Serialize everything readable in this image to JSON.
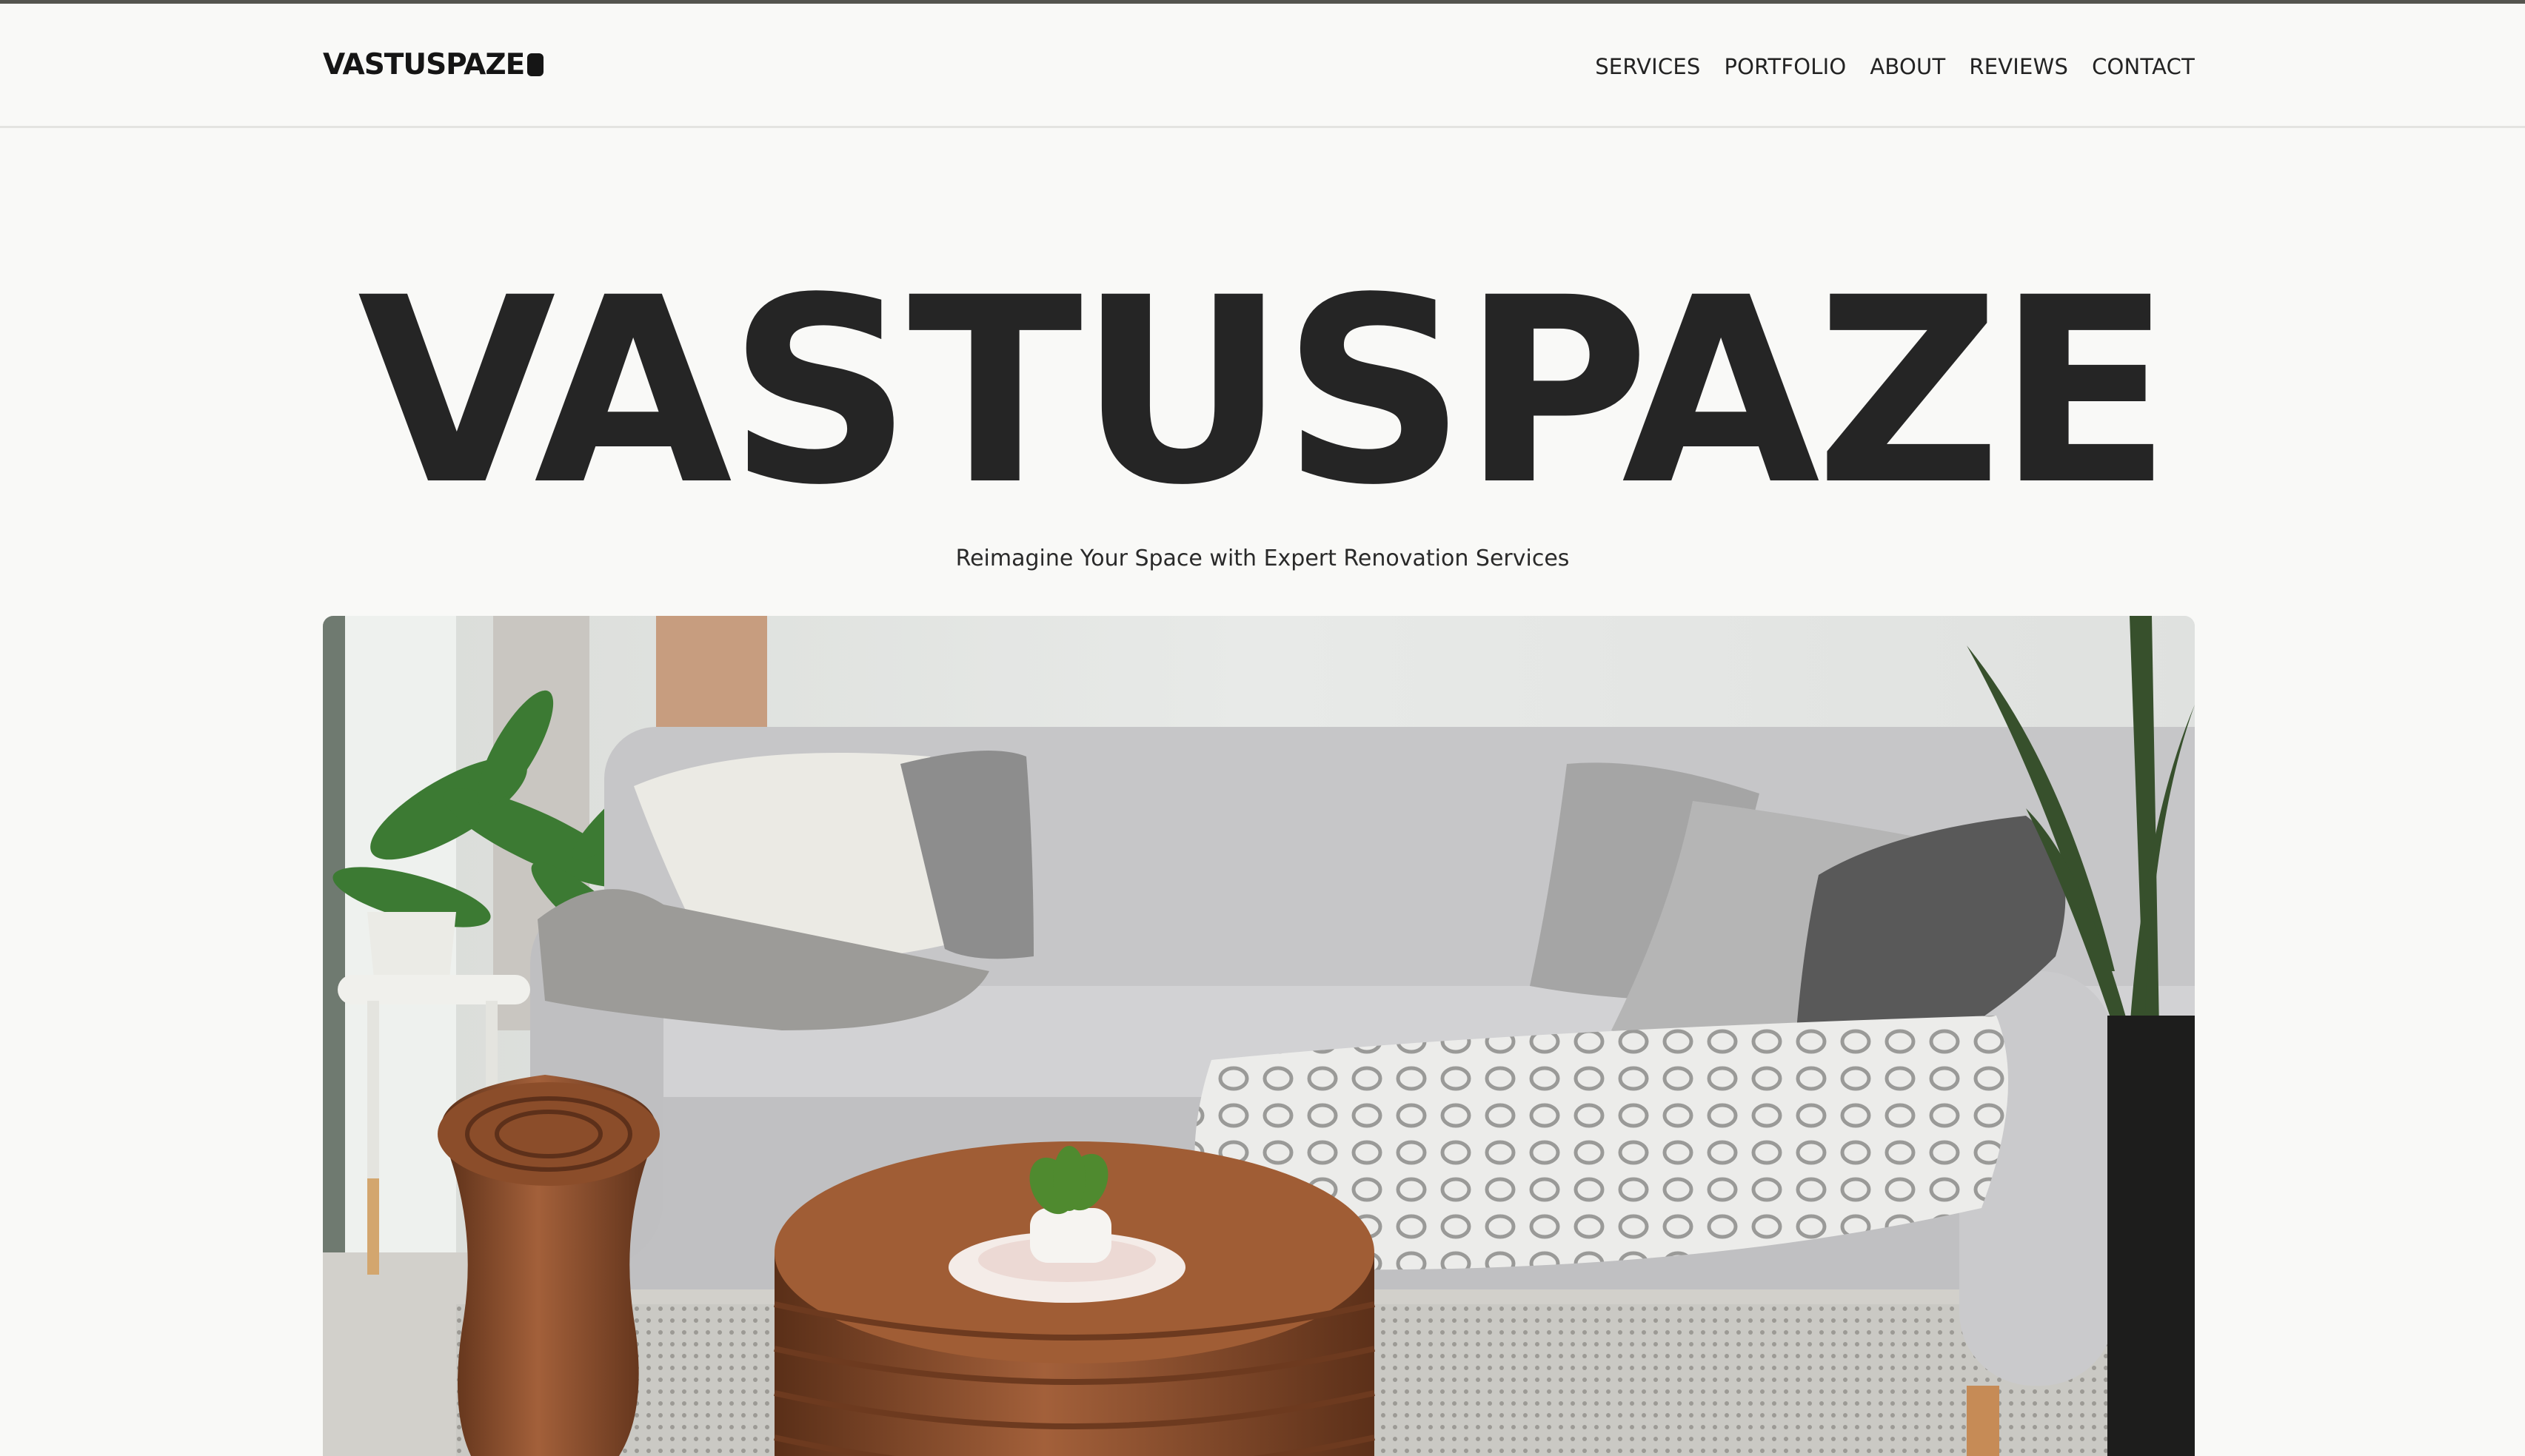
{
  "header": {
    "logo": "VASTUSPAZE",
    "logo_icon": "rounded-square-mark",
    "nav": [
      "SERVICES",
      "PORTFOLIO",
      "ABOUT",
      "REVIEWS",
      "CONTACT"
    ]
  },
  "hero": {
    "title": "VASTUSPAZE",
    "subtitle": "Reimagine Your Space with Expert Renovation Services",
    "image": "living-room-photo"
  },
  "colors": {
    "background": "#f9f9f7",
    "text": "#252525",
    "top_border": "#55554f"
  }
}
